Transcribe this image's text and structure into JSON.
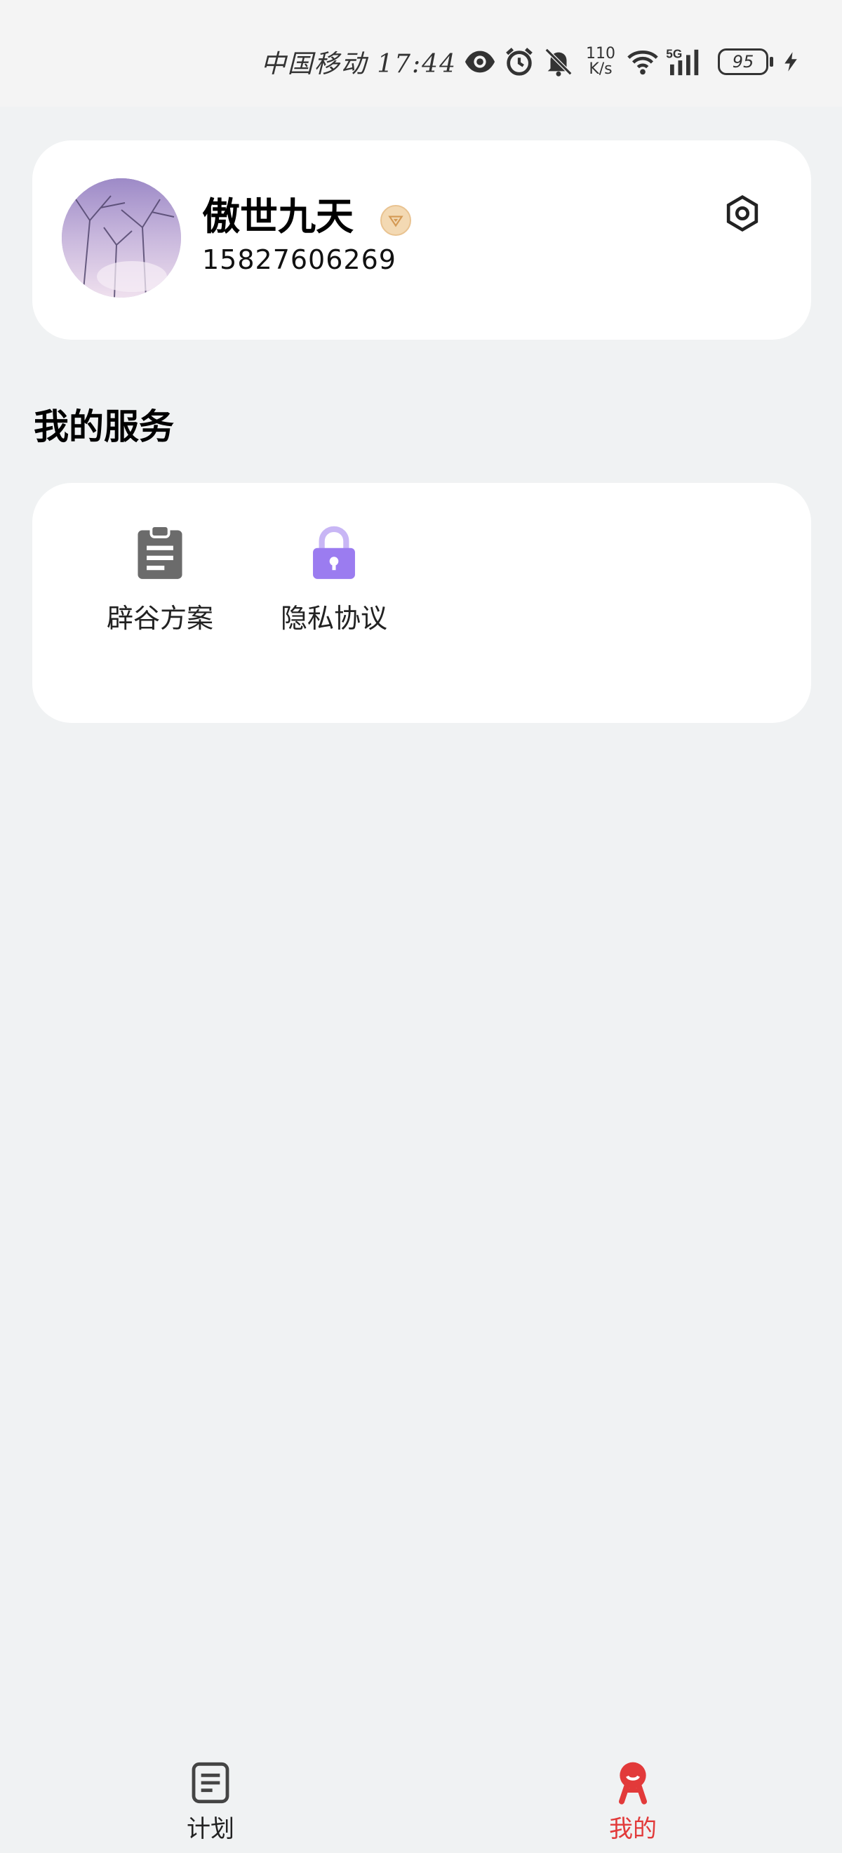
{
  "status_bar": {
    "carrier_time": "中国移动 17:44",
    "net_speed_value": "110",
    "net_speed_unit": "K/s",
    "network_type": "5G",
    "battery": "95",
    "icons": [
      "eye-icon",
      "alarm-icon",
      "mute-bell-icon",
      "wifi-icon",
      "signal-icon",
      "battery-icon",
      "charging-icon"
    ]
  },
  "profile": {
    "name": "傲世九天",
    "phone": "15827606269",
    "badge_icon": "vip-badge-icon",
    "settings_icon": "settings-hexagon-icon"
  },
  "services": {
    "title": "我的服务",
    "items": [
      {
        "label": "辟谷方案",
        "icon": "clipboard-icon",
        "color": "#6b6b6b"
      },
      {
        "label": "隐私协议",
        "icon": "lock-icon",
        "color": "#9b7cf0"
      }
    ]
  },
  "bottom_nav": {
    "items": [
      {
        "label": "计划",
        "icon": "plan-list-icon",
        "active": false
      },
      {
        "label": "我的",
        "icon": "profile-mascot-icon",
        "active": true
      }
    ],
    "active_color": "#e23a3a",
    "inactive_color": "#222222"
  }
}
